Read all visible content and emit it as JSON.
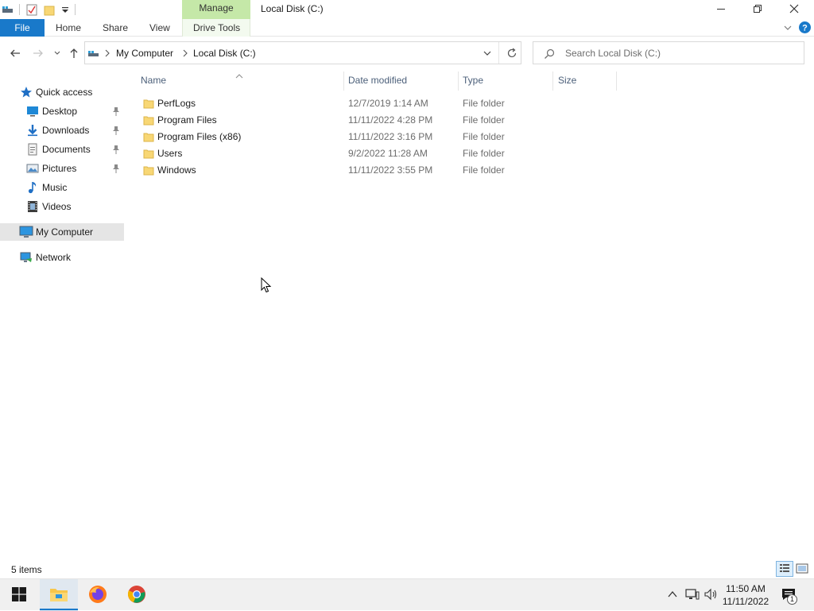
{
  "window": {
    "title": "Local Disk (C:)",
    "contextual_tab": "Manage"
  },
  "ribbon": {
    "tabs": [
      "File",
      "Home",
      "Share",
      "View",
      "Drive Tools"
    ]
  },
  "address": {
    "crumbs": [
      "My Computer",
      "Local Disk (C:)"
    ]
  },
  "search": {
    "placeholder": "Search Local Disk (C:)"
  },
  "sidebar": {
    "quick_access": "Quick access",
    "items": [
      {
        "label": "Desktop",
        "icon": "desktop-icon",
        "pinned": true
      },
      {
        "label": "Downloads",
        "icon": "downloads-icon",
        "pinned": true
      },
      {
        "label": "Documents",
        "icon": "documents-icon",
        "pinned": true
      },
      {
        "label": "Pictures",
        "icon": "pictures-icon",
        "pinned": true
      },
      {
        "label": "Music",
        "icon": "music-icon",
        "pinned": false
      },
      {
        "label": "Videos",
        "icon": "videos-icon",
        "pinned": false
      }
    ],
    "my_computer": "My Computer",
    "network": "Network"
  },
  "columns": {
    "name": "Name",
    "date": "Date modified",
    "type": "Type",
    "size": "Size"
  },
  "files": [
    {
      "name": "PerfLogs",
      "date": "12/7/2019 1:14 AM",
      "type": "File folder"
    },
    {
      "name": "Program Files",
      "date": "11/11/2022 4:28 PM",
      "type": "File folder"
    },
    {
      "name": "Program Files (x86)",
      "date": "11/11/2022 3:16 PM",
      "type": "File folder"
    },
    {
      "name": "Users",
      "date": "9/2/2022 11:28 AM",
      "type": "File folder"
    },
    {
      "name": "Windows",
      "date": "11/11/2022 3:55 PM",
      "type": "File folder"
    }
  ],
  "status": {
    "count": "5 items"
  },
  "taskbar": {
    "time": "11:50 AM",
    "date": "11/11/2022",
    "notification_count": "1"
  },
  "colors": {
    "file_tab": "#1979ca",
    "manage_tab": "#c5e8a8",
    "folder": "#f8d775",
    "selection": "#e5e5e5"
  }
}
